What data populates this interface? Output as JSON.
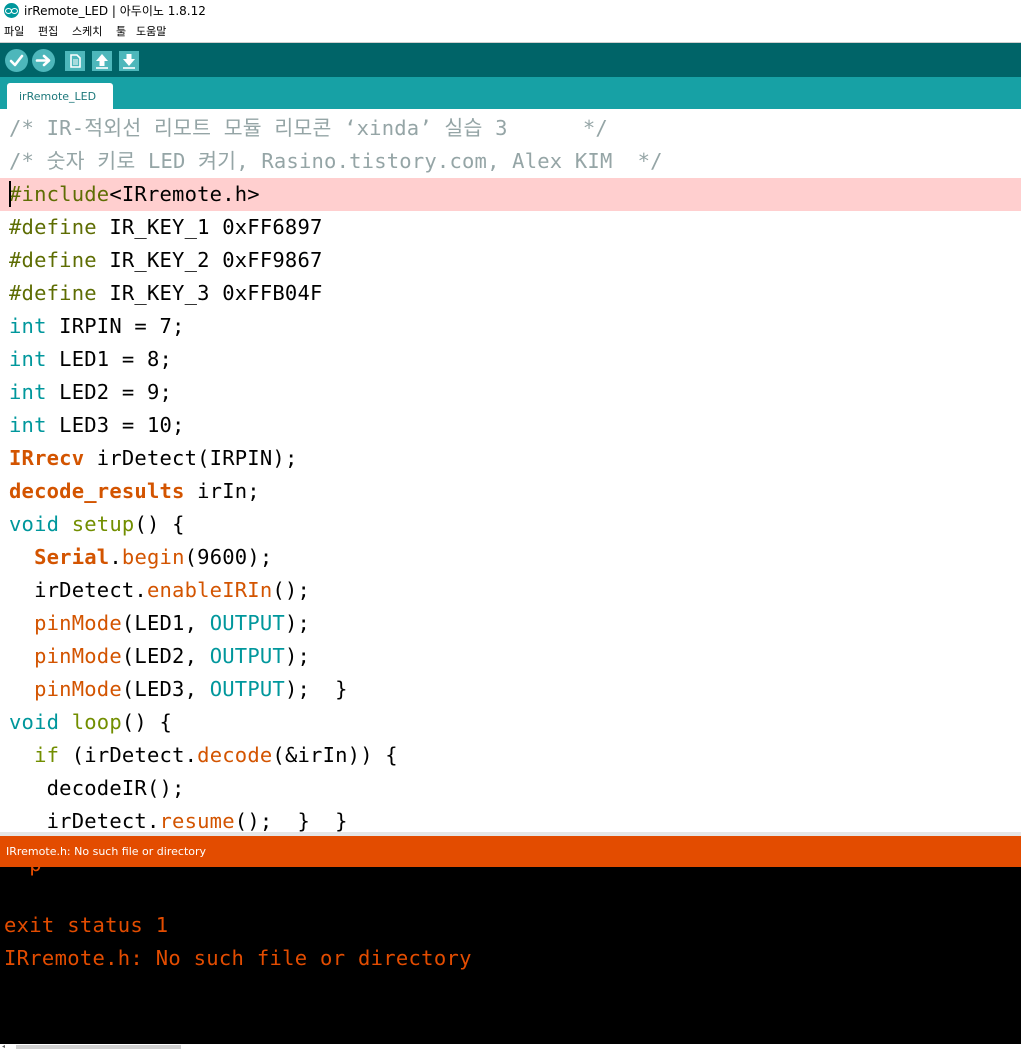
{
  "window": {
    "title": "irRemote_LED | 아두이노 1.8.12"
  },
  "menu": {
    "items": [
      "파일",
      "편집",
      "스케치",
      "툴",
      "도움말"
    ]
  },
  "toolbar": {
    "buttons": [
      "verify",
      "upload",
      "new",
      "open",
      "save"
    ]
  },
  "tabs": [
    {
      "label": "irRemote_LED",
      "active": true
    }
  ],
  "editor": {
    "highlighted_line": 3,
    "lines": [
      [
        [
          "c-comment",
          "/* IR-적외선 리모트 모듈 리모콘 ‘xinda’ 실습 3      */"
        ]
      ],
      [
        [
          "c-comment",
          "/* 숫자 키로 LED 켜기, Rasino.tistory.com, Alex KIM  */"
        ]
      ],
      [
        [
          "c-pre",
          "#include"
        ],
        [
          "",
          "<IRremote.h>"
        ]
      ],
      [
        [
          "c-pre",
          "#define"
        ],
        [
          "",
          " IR_KEY_1 0xFF6897"
        ]
      ],
      [
        [
          "c-pre",
          "#define"
        ],
        [
          "",
          " IR_KEY_2 0xFF9867"
        ]
      ],
      [
        [
          "c-pre",
          "#define"
        ],
        [
          "",
          " IR_KEY_3 0xFFB04F"
        ]
      ],
      [
        [
          "c-type",
          "int"
        ],
        [
          "",
          " IRPIN = 7;"
        ]
      ],
      [
        [
          "c-type",
          "int"
        ],
        [
          "",
          " LED1 = 8;"
        ]
      ],
      [
        [
          "c-type",
          "int"
        ],
        [
          "",
          " LED2 = 9;"
        ]
      ],
      [
        [
          "c-type",
          "int"
        ],
        [
          "",
          " LED3 = 10;"
        ]
      ],
      [
        [
          "c-class",
          "IRrecv"
        ],
        [
          "",
          " irDetect(IRPIN);"
        ]
      ],
      [
        [
          "c-class",
          "decode_results"
        ],
        [
          "",
          " irIn;"
        ]
      ],
      [
        [
          "c-type",
          "void"
        ],
        [
          "",
          " "
        ],
        [
          "c-kw",
          "setup"
        ],
        [
          "",
          "() {"
        ]
      ],
      [
        [
          "",
          "  "
        ],
        [
          "c-class",
          "Serial"
        ],
        [
          "",
          "."
        ],
        [
          "c-func",
          "begin"
        ],
        [
          "",
          "(9600);"
        ]
      ],
      [
        [
          "",
          "  irDetect."
        ],
        [
          "c-func",
          "enableIRIn"
        ],
        [
          "",
          "();"
        ]
      ],
      [
        [
          "",
          "  "
        ],
        [
          "c-func",
          "pinMode"
        ],
        [
          "",
          "(LED1, "
        ],
        [
          "c-const",
          "OUTPUT"
        ],
        [
          "",
          ");"
        ]
      ],
      [
        [
          "",
          "  "
        ],
        [
          "c-func",
          "pinMode"
        ],
        [
          "",
          "(LED2, "
        ],
        [
          "c-const",
          "OUTPUT"
        ],
        [
          "",
          ");"
        ]
      ],
      [
        [
          "",
          "  "
        ],
        [
          "c-func",
          "pinMode"
        ],
        [
          "",
          "(LED3, "
        ],
        [
          "c-const",
          "OUTPUT"
        ],
        [
          "",
          ");  }"
        ]
      ],
      [
        [
          "c-type",
          "void"
        ],
        [
          "",
          " "
        ],
        [
          "c-kw",
          "loop"
        ],
        [
          "",
          "() {"
        ]
      ],
      [
        [
          "",
          "  "
        ],
        [
          "c-kw",
          "if"
        ],
        [
          "",
          " (irDetect."
        ],
        [
          "c-func",
          "decode"
        ],
        [
          "",
          "(&irIn)) {"
        ]
      ],
      [
        [
          "",
          "   decodeIR();"
        ]
      ],
      [
        [
          "",
          "   irDetect."
        ],
        [
          "c-func",
          "resume"
        ],
        [
          "",
          "();  }  }"
        ]
      ]
    ]
  },
  "status": {
    "message": "IRremote.h: No such file or directory",
    "color": "#e34c00"
  },
  "console": {
    "partial_top": "  p",
    "lines": [
      "",
      "exit status 1",
      "IRremote.h: No such file or directory"
    ]
  },
  "colors": {
    "toolbar": "#006468",
    "tabbar": "#17a1a5",
    "status": "#e34c00",
    "highlight": "#ffcfcf"
  }
}
